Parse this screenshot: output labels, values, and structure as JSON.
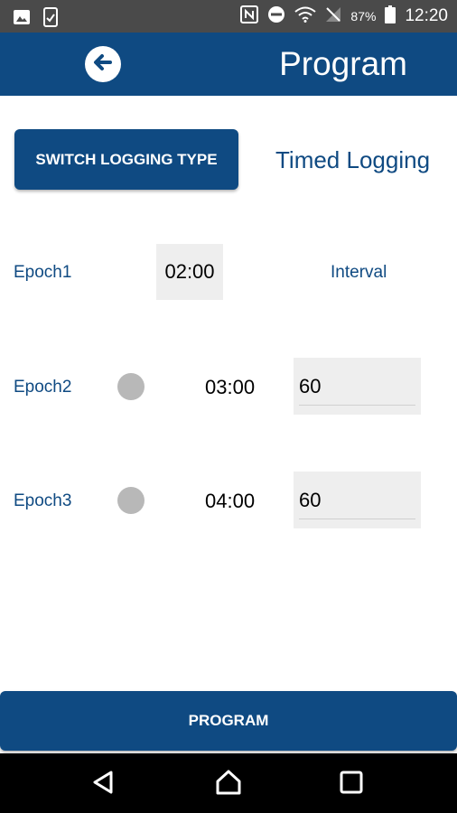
{
  "status_bar": {
    "battery": "87%",
    "time": "12:20"
  },
  "app_bar": {
    "title": "Program"
  },
  "switch_button_label": "SWITCH LOGGING TYPE",
  "logging_type": "Timed Logging",
  "interval_header": "Interval",
  "epochs": [
    {
      "label": "Epoch1",
      "time": "02:00"
    },
    {
      "label": "Epoch2",
      "time": "03:00",
      "interval": "60"
    },
    {
      "label": "Epoch3",
      "time": "04:00",
      "interval": "60"
    }
  ],
  "program_button_label": "PROGRAM",
  "colors": {
    "primary": "#0f4a82",
    "status_bar": "#4a4a4a",
    "field_bg": "#eeeeee",
    "toggle_off": "#b8b8b8"
  }
}
